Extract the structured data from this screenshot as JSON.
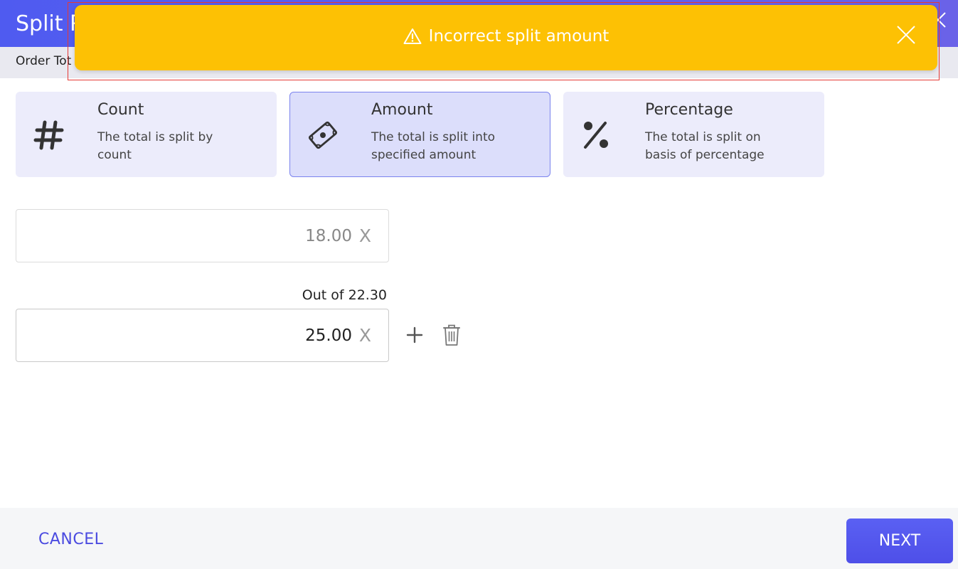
{
  "header": {
    "title": "Split P",
    "close_icon": "close-icon"
  },
  "subheader": {
    "text": "Order Tot"
  },
  "toast": {
    "message": "Incorrect split amount",
    "icon": "warning-icon",
    "background": "#fdc104"
  },
  "split_options": [
    {
      "title": "Count",
      "description": "The total is split by count",
      "icon": "hash-icon"
    },
    {
      "title": "Amount",
      "description": "The total is split into specified amount",
      "icon": "money-bill-icon",
      "selected": true
    },
    {
      "title": "Percentage",
      "description": "The total is split on basis of percentage",
      "icon": "percent-icon"
    }
  ],
  "amounts": {
    "first": {
      "value": "18.00",
      "clear_label": "X"
    },
    "second": {
      "value": "25.00",
      "clear_label": "X",
      "out_of": "Out of 22.30"
    }
  },
  "footer": {
    "cancel_label": "CANCEL",
    "next_label": "NEXT"
  },
  "colors": {
    "accent": "#4f5bf0",
    "warning": "#fdc104"
  }
}
